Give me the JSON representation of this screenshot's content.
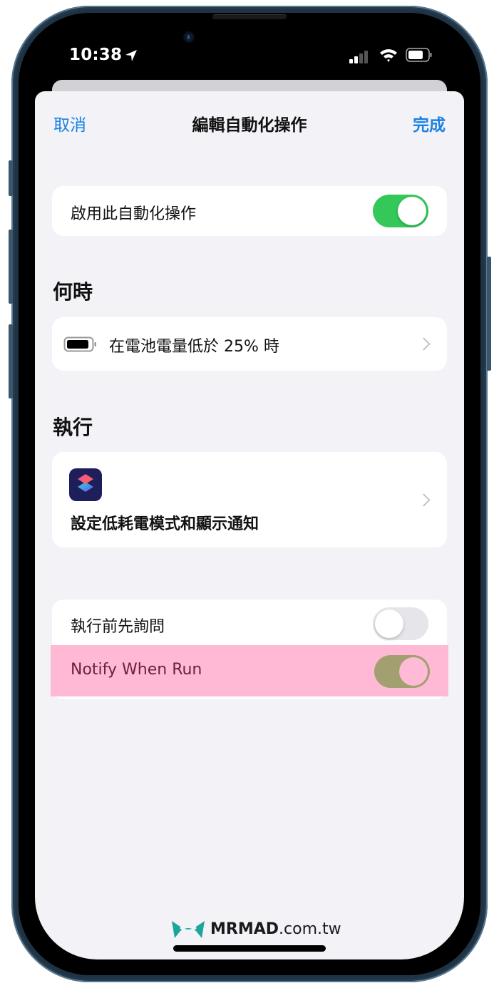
{
  "status_bar": {
    "time": "10:38",
    "location_icon": "location-arrow-icon",
    "signal_icon": "cellular-signal-icon",
    "wifi_icon": "wifi-icon",
    "battery_icon": "battery-icon"
  },
  "nav": {
    "cancel": "取消",
    "title": "編輯自動化操作",
    "done": "完成"
  },
  "enable_row": {
    "label": "啟用此自動化操作",
    "toggle_on": true
  },
  "when": {
    "header": "何時",
    "trigger": {
      "icon": "battery-icon",
      "label": "在電池電量低於 25% 時"
    }
  },
  "do": {
    "header": "執行",
    "action": {
      "icon": "shortcuts-app-icon",
      "label": "設定低耗電模式和顯示通知"
    }
  },
  "options": [
    {
      "label": "執行前先詢問",
      "toggle_on": false
    },
    {
      "label": "Notify When Run",
      "toggle_on": true,
      "highlighted": true
    }
  ],
  "colors": {
    "accent": "#1a82e2",
    "toggle_on": "#34c759",
    "highlight": "#ffb9d5"
  },
  "watermark": {
    "brand": "MRMAD",
    "domain": ".com.tw"
  }
}
